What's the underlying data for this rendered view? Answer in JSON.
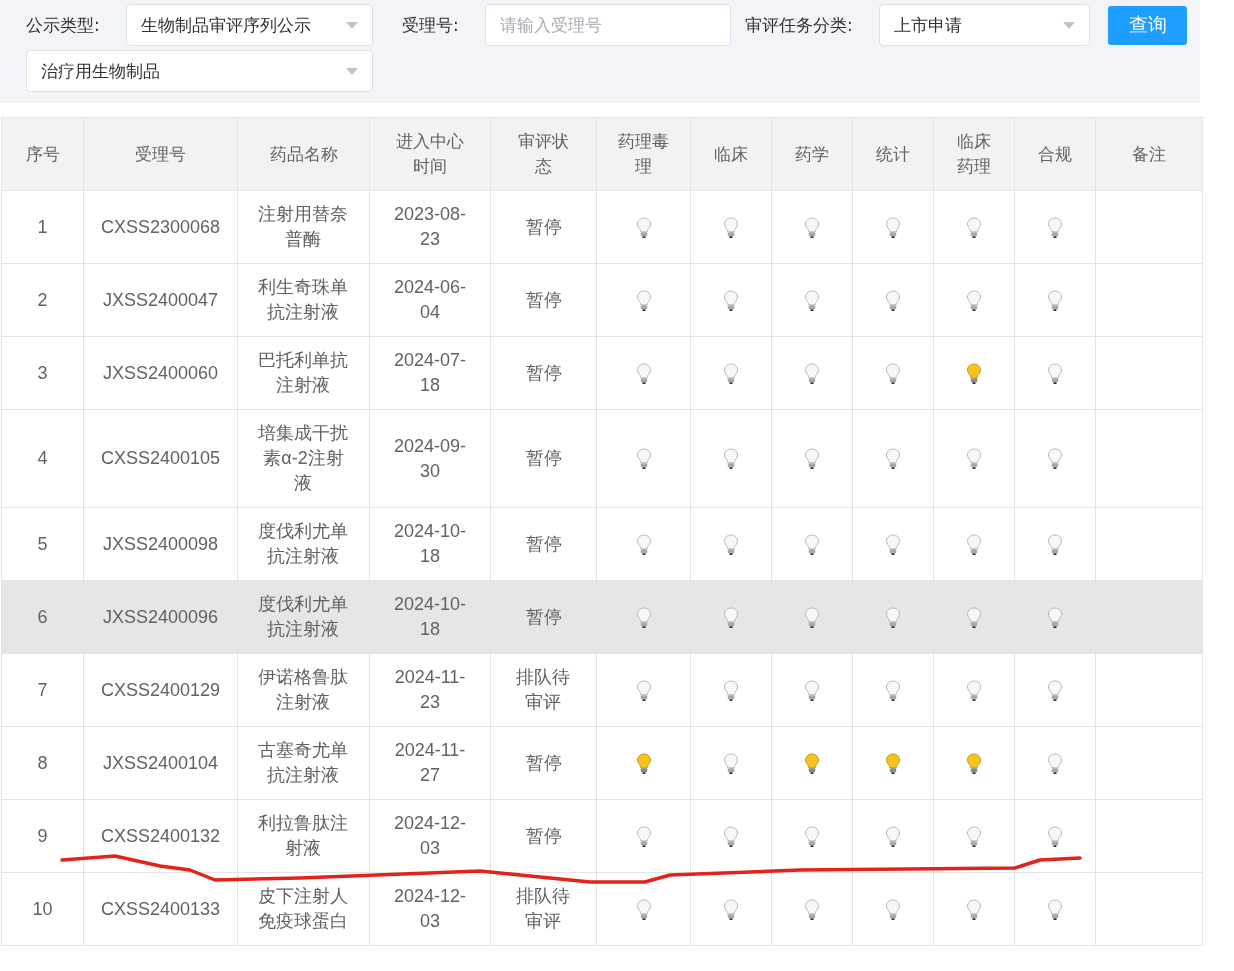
{
  "filters": [
    {
      "kind": "select",
      "label": "公示类型:",
      "value": "生物制品审评序列公示"
    },
    {
      "kind": "input",
      "label": "受理号:",
      "placeholder": "请输入受理号"
    },
    {
      "kind": "select",
      "label": "审评任务分类:",
      "value": "上市申请"
    },
    {
      "kind": "button",
      "label": "查询"
    },
    {
      "kind": "select",
      "value": "治疗用生物制品"
    }
  ],
  "table": {
    "columns": [
      "序号",
      "受理号",
      "药品名称",
      "进入中心时间",
      "审评状态",
      "药理毒理",
      "临床",
      "药学",
      "统计",
      "临床药理",
      "合规",
      "备注"
    ],
    "rows": [
      {
        "no": "1",
        "id": "CXSS2300068",
        "name": "注射用替奈普酶",
        "date": "2023-08-23",
        "status": "暂停",
        "lights": [
          false,
          false,
          false,
          false,
          false,
          false
        ],
        "selected": false
      },
      {
        "no": "2",
        "id": "JXSS2400047",
        "name": "利生奇珠单抗注射液",
        "date": "2024-06-04",
        "status": "暂停",
        "lights": [
          false,
          false,
          false,
          false,
          false,
          false
        ],
        "selected": false
      },
      {
        "no": "3",
        "id": "JXSS2400060",
        "name": "巴托利单抗注射液",
        "date": "2024-07-18",
        "status": "暂停",
        "lights": [
          false,
          false,
          false,
          false,
          true,
          false
        ],
        "selected": false
      },
      {
        "no": "4",
        "id": "CXSS2400105",
        "name": "培集成干扰素α-2注射液",
        "date": "2024-09-30",
        "status": "暂停",
        "lights": [
          false,
          false,
          false,
          false,
          false,
          false
        ],
        "selected": false
      },
      {
        "no": "5",
        "id": "JXSS2400098",
        "name": "度伐利尤单抗注射液",
        "date": "2024-10-18",
        "status": "暂停",
        "lights": [
          false,
          false,
          false,
          false,
          false,
          false
        ],
        "selected": false
      },
      {
        "no": "6",
        "id": "JXSS2400096",
        "name": "度伐利尤单抗注射液",
        "date": "2024-10-18",
        "status": "暂停",
        "lights": [
          false,
          false,
          false,
          false,
          false,
          false
        ],
        "selected": true
      },
      {
        "no": "7",
        "id": "CXSS2400129",
        "name": "伊诺格鲁肽注射液",
        "date": "2024-11-23",
        "status": "排队待审评",
        "lights": [
          false,
          false,
          false,
          false,
          false,
          false
        ],
        "selected": false
      },
      {
        "no": "8",
        "id": "JXSS2400104",
        "name": "古塞奇尤单抗注射液",
        "date": "2024-11-27",
        "status": "暂停",
        "lights": [
          true,
          false,
          true,
          true,
          true,
          false
        ],
        "selected": false
      },
      {
        "no": "9",
        "id": "CXSS2400132",
        "name": "利拉鲁肽注射液",
        "date": "2024-12-03",
        "status": "暂停",
        "lights": [
          false,
          false,
          false,
          false,
          false,
          false
        ],
        "selected": false
      },
      {
        "no": "10",
        "id": "CXSS2400133",
        "name": "皮下注射人免疫球蛋白",
        "date": "2024-12-03",
        "status": "排队待审评",
        "lights": [
          false,
          false,
          false,
          false,
          false,
          false
        ],
        "selected": false
      }
    ]
  }
}
